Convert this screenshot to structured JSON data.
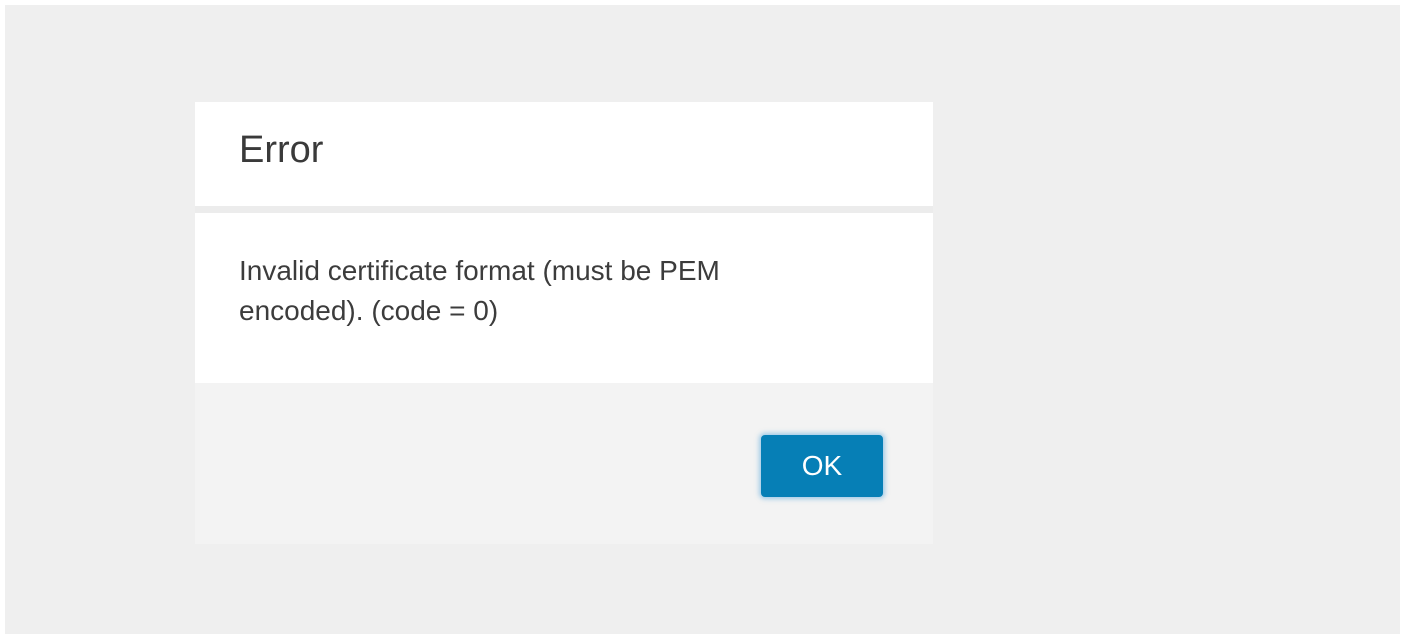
{
  "dialog": {
    "title": "Error",
    "message_line1": "Invalid certificate format (must be PEM",
    "message_line2": "encoded). (code = 0)",
    "ok_label": "OK"
  },
  "colors": {
    "backdrop": "#efefef",
    "dialog_background": "#ffffff",
    "footer_background": "#f3f3f3",
    "ok_button": "#067fb6",
    "title_text": "#3a3a3a",
    "message_text": "#3c3c3c"
  }
}
